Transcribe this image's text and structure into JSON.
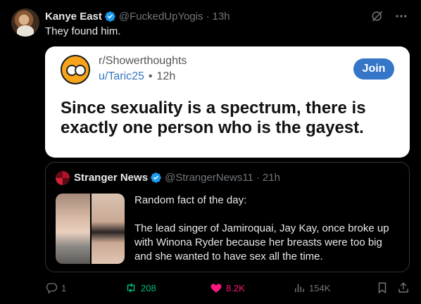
{
  "tweet": {
    "author_name": "Kanye East",
    "handle": "@FuckedUpYogis",
    "separator": "·",
    "time": "13h",
    "text": "They found him."
  },
  "reddit_card": {
    "subreddit": "r/Showerthoughts",
    "user": "u/Taric25",
    "separator": "•",
    "time": "12h",
    "join_label": "Join",
    "title": "Since sexuality is a spectrum, there is exactly one person who is the gayest."
  },
  "quote": {
    "author_name": "Stranger News",
    "handle": "@StrangerNews11",
    "separator": "·",
    "time": "21h",
    "text": "Random fact of the day:\n\nThe lead singer of Jamiroquai, Jay Kay, once broke up with Winona Ryder because her breasts were too big and she wanted to have sex all the time."
  },
  "actions": {
    "replies": "1",
    "retweets": "208",
    "likes": "8.2K",
    "views": "154K"
  },
  "icons": {
    "verified": "verified-badge-icon",
    "grok": "grok-icon",
    "more": "more-icon",
    "reply": "reply-icon",
    "retweet": "retweet-icon",
    "like": "heart-icon",
    "views": "views-icon",
    "bookmark": "bookmark-icon",
    "share": "share-icon"
  },
  "colors": {
    "background": "#000000",
    "verified": "#1d9bf0",
    "retweet": "#00ba7c",
    "like": "#f91880",
    "join": "#3576c8",
    "muted": "#71767b"
  }
}
